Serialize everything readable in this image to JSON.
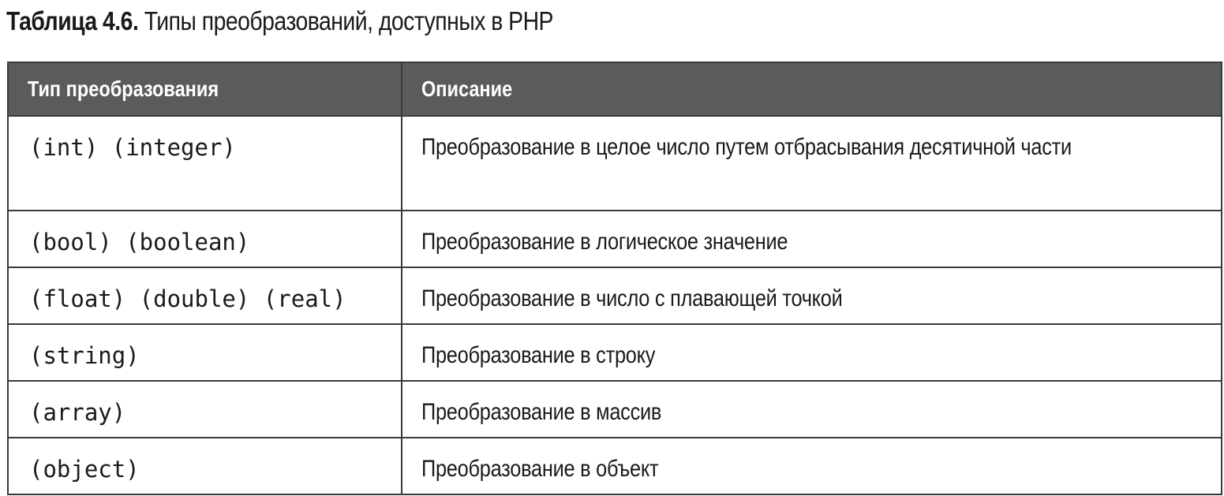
{
  "caption": {
    "number": "Таблица 4.6.",
    "text": "Типы преобразований, доступных в PHP"
  },
  "table": {
    "headers": [
      "Тип преобразования",
      "Описание"
    ],
    "rows": [
      {
        "type": "(int) (integer)",
        "description": "Преобразование в целое число путем отбрасывания десятичной части"
      },
      {
        "type": "(bool) (boolean)",
        "description": "Преобразование в логическое значение"
      },
      {
        "type": "(float) (double) (real)",
        "description": "Преобразование в число с плавающей точкой"
      },
      {
        "type": "(string)",
        "description": "Преобразование в строку"
      },
      {
        "type": "(array)",
        "description": "Преобразование в массив"
      },
      {
        "type": "(object)",
        "description": "Преобразование в объект"
      }
    ]
  },
  "colors": {
    "header_background": "#5a5b5d",
    "header_text": "#ffffff",
    "border": "#3a3a3a"
  }
}
